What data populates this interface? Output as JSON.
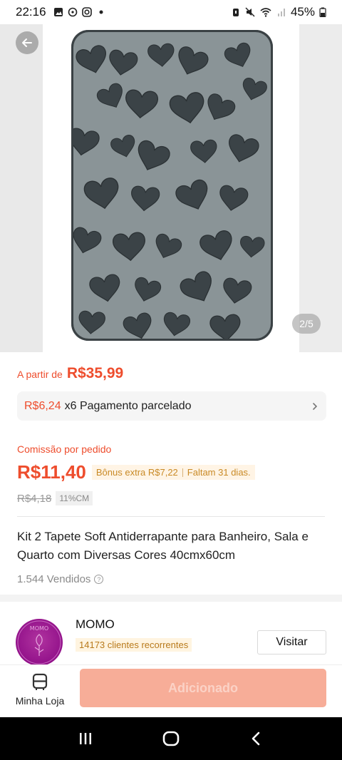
{
  "status_bar": {
    "time": "22:16",
    "battery": "45%",
    "icons": [
      "gallery-icon",
      "pinwheel-icon",
      "instagram-icon",
      "dot-icon",
      "alarm-icon",
      "mute-icon",
      "wifi-icon",
      "signal-icon",
      "battery-icon"
    ]
  },
  "gallery": {
    "page_indicator": "2/5"
  },
  "price": {
    "from_label": "A partir de",
    "from_value": "R$35,99"
  },
  "installment": {
    "amount": "R$6,24",
    "text": "x6 Pagamento parcelado"
  },
  "commission": {
    "label": "Comissão por pedido",
    "value": "R$11,40",
    "bonus": "Bônus extra R$7,22",
    "remaining": "Faltam 31 dias.",
    "old_value": "R$4,18",
    "cm_rate": "11%CM"
  },
  "product": {
    "title": "Kit 2 Tapete Soft Antiderrapante para Banheiro, Sala e Quarto com Diversas Cores 40cmx60cm",
    "sold": "1.544 Vendidos"
  },
  "shop": {
    "name": "MOMO",
    "recurring": "14173 clientes recorrentes",
    "visit_label": "Visitar",
    "avatar_text": "MOMO"
  },
  "bottom": {
    "my_store_label": "Minha Loja",
    "add_label": "Adicionado"
  },
  "colors": {
    "accent": "#ee4d2d",
    "add_button": "#f7ad98",
    "shop_avatar": "#92118a"
  }
}
